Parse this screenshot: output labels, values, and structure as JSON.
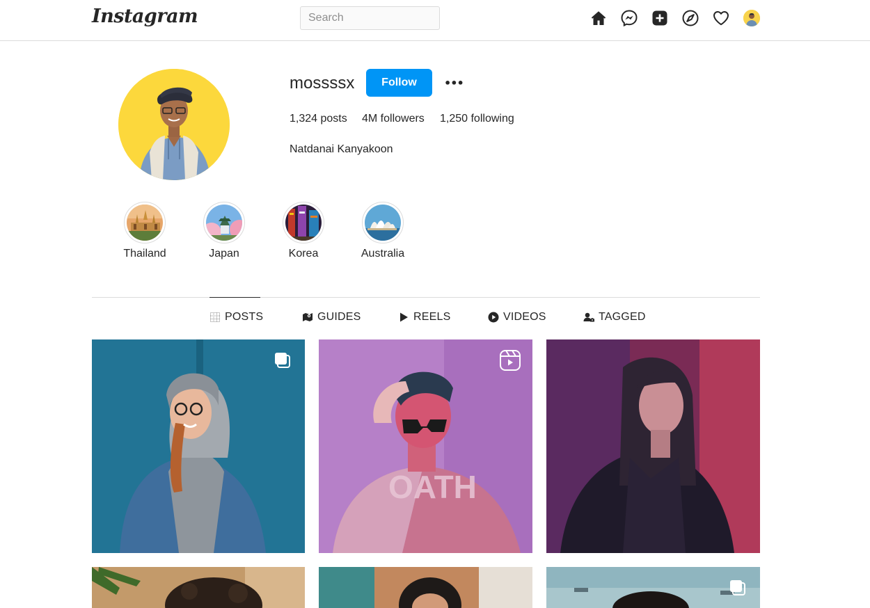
{
  "nav": {
    "logo": "Instagram",
    "search_placeholder": "Search",
    "icons": [
      "home-icon",
      "messenger-icon",
      "new-post-icon",
      "explore-icon",
      "activity-heart-icon",
      "profile-avatar-icon"
    ]
  },
  "profile": {
    "username": "mossssx",
    "follow_label": "Follow",
    "more_label": "•••",
    "stats": {
      "posts": "1,324 posts",
      "followers": "4M followers",
      "following": "1,250 following"
    },
    "full_name": "Natdanai Kanyakoon"
  },
  "highlights": [
    {
      "label": "Thailand"
    },
    {
      "label": "Japan"
    },
    {
      "label": "Korea"
    },
    {
      "label": "Australia"
    }
  ],
  "tabs": [
    {
      "label": "POSTS",
      "icon": "grid-icon",
      "active": true
    },
    {
      "label": "GUIDES",
      "icon": "map-icon",
      "active": false
    },
    {
      "label": "REELS",
      "icon": "play-icon",
      "active": false
    },
    {
      "label": "VIDEOS",
      "icon": "video-circle-icon",
      "active": false
    },
    {
      "label": "TAGGED",
      "icon": "user-tag-icon",
      "active": false
    }
  ],
  "posts": [
    {
      "badge": "carousel-icon"
    },
    {
      "badge": "reel-icon"
    },
    {
      "badge": ""
    },
    {
      "badge": ""
    },
    {
      "badge": ""
    },
    {
      "badge": "carousel-icon"
    }
  ],
  "colors": {
    "accent": "#0095f6",
    "text": "#262626",
    "border": "#dbdbdb"
  }
}
